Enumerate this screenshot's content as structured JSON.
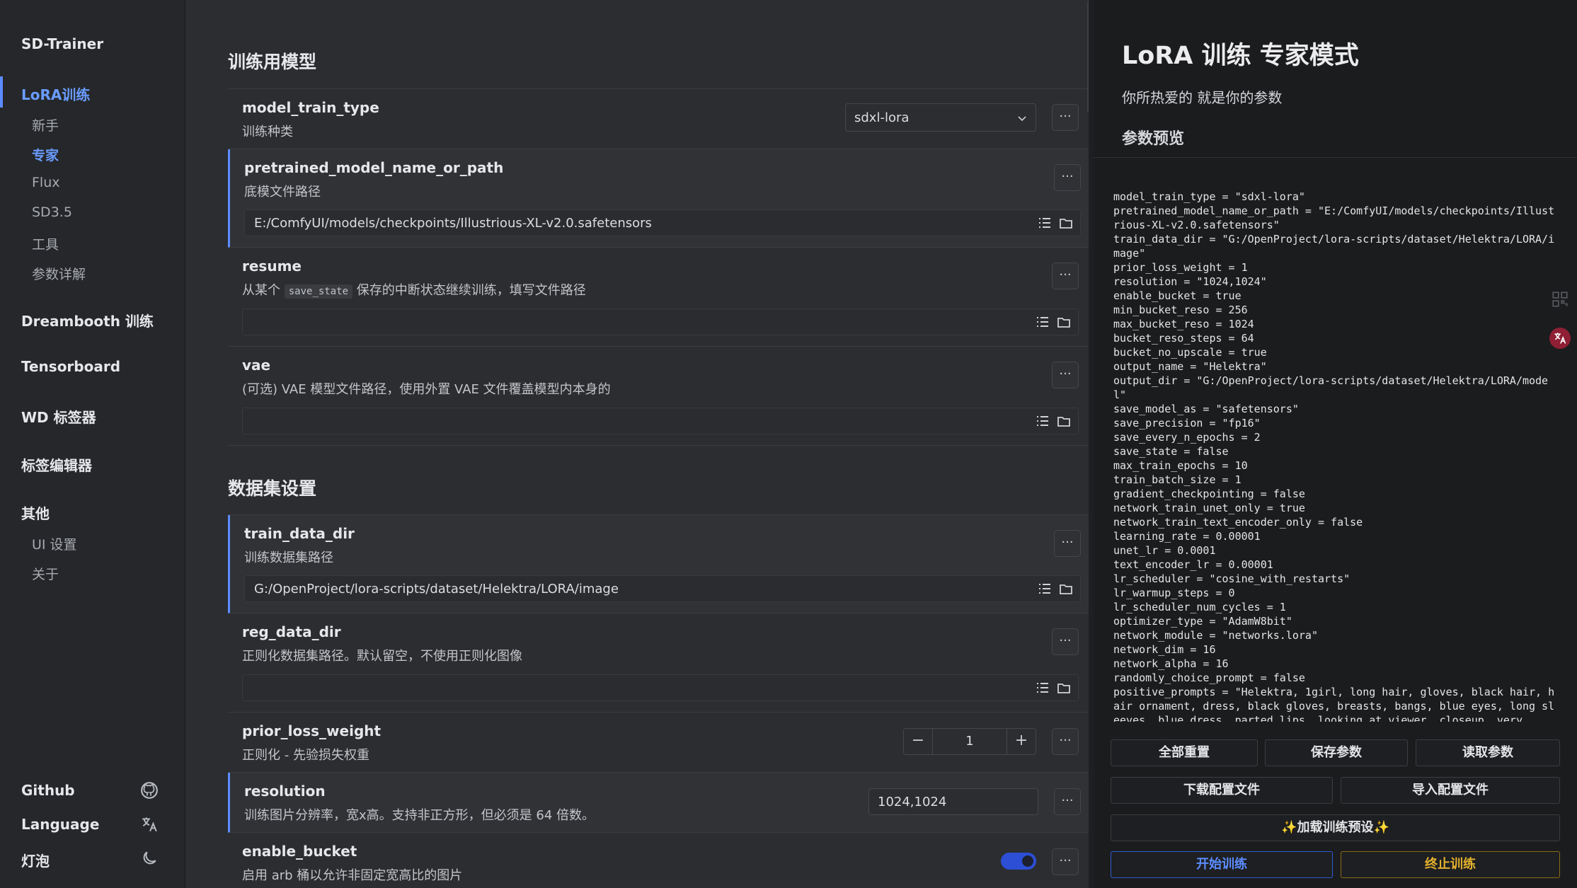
{
  "sidebar": {
    "brand": "SD-Trainer",
    "nav_lora": "LoRA训练",
    "sub_items": [
      "新手",
      "专家",
      "Flux",
      "SD3.5",
      "工具",
      "参数详解"
    ],
    "nav_dreambooth": "Dreambooth 训练",
    "nav_tensorboard": "Tensorboard",
    "nav_wd": "WD 标签器",
    "nav_tag_editor": "标签编辑器",
    "nav_other": "其他",
    "other_items": [
      "UI 设置",
      "关于"
    ],
    "footer": [
      "Github",
      "Language",
      "灯泡"
    ]
  },
  "main": {
    "section_model": "训练用模型",
    "section_dataset": "数据集设置",
    "dots": "···",
    "rows": {
      "model_train_type": {
        "name": "model_train_type",
        "desc": "训练种类",
        "value": "sdxl-lora"
      },
      "pretrained": {
        "name": "pretrained_model_name_or_path",
        "desc": "底模文件路径",
        "value": "E:/ComfyUI/models/checkpoints/Illustrious-XL-v2.0.safetensors"
      },
      "resume": {
        "name": "resume",
        "desc_pre": "从某个",
        "desc_code": "save_state",
        "desc_post": "保存的中断状态继续训练，填写文件路径",
        "value": ""
      },
      "vae": {
        "name": "vae",
        "desc": "(可选) VAE 模型文件路径，使用外置 VAE 文件覆盖模型内本身的",
        "value": ""
      },
      "train_data_dir": {
        "name": "train_data_dir",
        "desc": "训练数据集路径",
        "value": "G:/OpenProject/lora-scripts/dataset/Helektra/LORA/image"
      },
      "reg_data_dir": {
        "name": "reg_data_dir",
        "desc": "正则化数据集路径。默认留空，不使用正则化图像",
        "value": ""
      },
      "prior_loss_weight": {
        "name": "prior_loss_weight",
        "desc": "正则化 - 先验损失权重",
        "value": "1",
        "minus": "−",
        "plus": "+"
      },
      "resolution": {
        "name": "resolution",
        "desc": "训练图片分辨率，宽x高。支持非正方形，但必须是 64 倍数。",
        "value": "1024,1024"
      },
      "enable_bucket": {
        "name": "enable_bucket",
        "desc": "启用 arb 桶以允许非固定宽高比的图片",
        "value": true
      }
    }
  },
  "panel": {
    "title": "LoRA 训练 专家模式",
    "subtitle": "你所热爱的 就是你的参数",
    "preview_title": "参数预览",
    "preview_text": "model_train_type = \"sdxl-lora\"\npretrained_model_name_or_path = \"E:/ComfyUI/models/checkpoints/Illustrious-XL-v2.0.safetensors\"\ntrain_data_dir = \"G:/OpenProject/lora-scripts/dataset/Helektra/LORA/image\"\nprior_loss_weight = 1\nresolution = \"1024,1024\"\nenable_bucket = true\nmin_bucket_reso = 256\nmax_bucket_reso = 1024\nbucket_reso_steps = 64\nbucket_no_upscale = true\noutput_name = \"Helektra\"\noutput_dir = \"G:/OpenProject/lora-scripts/dataset/Helektra/LORA/model\"\nsave_model_as = \"safetensors\"\nsave_precision = \"fp16\"\nsave_every_n_epochs = 2\nsave_state = false\nmax_train_epochs = 10\ntrain_batch_size = 1\ngradient_checkpointing = false\nnetwork_train_unet_only = true\nnetwork_train_text_encoder_only = false\nlearning_rate = 0.00001\nunet_lr = 0.0001\ntext_encoder_lr = 0.00001\nlr_scheduler = \"cosine_with_restarts\"\nlr_warmup_steps = 0\nlr_scheduler_num_cycles = 1\noptimizer_type = \"AdamW8bit\"\nnetwork_module = \"networks.lora\"\nnetwork_dim = 16\nnetwork_alpha = 16\nrandomly_choice_prompt = false\npositive_prompts = \"Helektra, 1girl, long hair, gloves, black hair, hair ornament, dress, black gloves, breasts, bangs, blue eyes, long sleeves, blue dress, parted lips, looking at viewer, closeup, very",
    "buttons": {
      "reset_all": "全部重置",
      "save_params": "保存参数",
      "load_params": "读取参数",
      "download_config": "下载配置文件",
      "import_config": "导入配置文件",
      "load_preset": "✨加载训练预设✨",
      "start_training": "开始训练",
      "stop_training": "终止训练"
    }
  },
  "colors": {
    "accent": "#5b8cff",
    "warn": "#e3b12d"
  }
}
